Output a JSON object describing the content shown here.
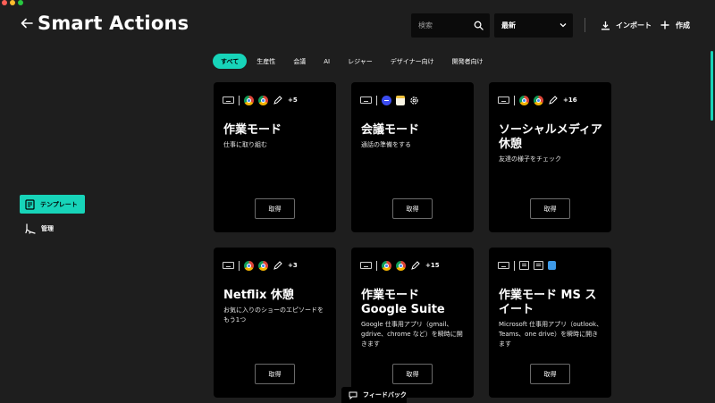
{
  "header": {
    "title": "Smart Actions",
    "search_placeholder": "検索",
    "sort_value": "最新",
    "import_label": "インポート",
    "create_label": "作成"
  },
  "sidebar": {
    "items": [
      {
        "label": "テンプレート",
        "icon": "template-icon"
      },
      {
        "label": "管理",
        "icon": "manage-icon"
      }
    ]
  },
  "filters": [
    "すべて",
    "生産性",
    "会議",
    "AI",
    "レジャー",
    "デザイナー向け",
    "開発者向け"
  ],
  "cards": [
    {
      "title": "作業モード",
      "description": "仕事に取り組む",
      "icons": [
        "keyboard-icon",
        "chrome-icon",
        "chrome-icon",
        "pen-icon"
      ],
      "more": "+5",
      "button": "取得"
    },
    {
      "title": "会議モード",
      "description": "通話の準備をする",
      "icons": [
        "keyboard-icon",
        "meeting-app-icon",
        "notes-icon",
        "gear-icon"
      ],
      "more": "",
      "button": "取得"
    },
    {
      "title": "ソーシャルメディア休憩",
      "description": "友達の様子をチェック",
      "icons": [
        "keyboard-icon",
        "chrome-icon",
        "chrome-icon",
        "pen-icon"
      ],
      "more": "+16",
      "button": "取得"
    },
    {
      "title": "Netflix 休憩",
      "description": "お気に入りのショーのエピソードをもう1つ",
      "icons": [
        "keyboard-icon",
        "chrome-icon",
        "chrome-icon",
        "pen-icon"
      ],
      "more": "+3",
      "button": "取得"
    },
    {
      "title": "作業モード Google Suite",
      "description": "Google 仕事用アプリ（gmail、gdrive、chrome など）を瞬時に開きます",
      "icons": [
        "keyboard-icon",
        "chrome-icon",
        "chrome-icon",
        "pen-icon"
      ],
      "more": "+15",
      "button": "取得"
    },
    {
      "title": "作業モード MS スイート",
      "description": "Microsoft 仕事用アプリ（outlook、Teams、one drive）を瞬時に開きます",
      "icons": [
        "keyboard-icon",
        "teams-icon",
        "teams-icon",
        "onedrive-icon"
      ],
      "more": "",
      "button": "取得"
    }
  ],
  "feedback_label": "フィードバック",
  "colors": {
    "accent": "#17d4b9",
    "background": "#1e1e1e",
    "card": "#000000"
  }
}
